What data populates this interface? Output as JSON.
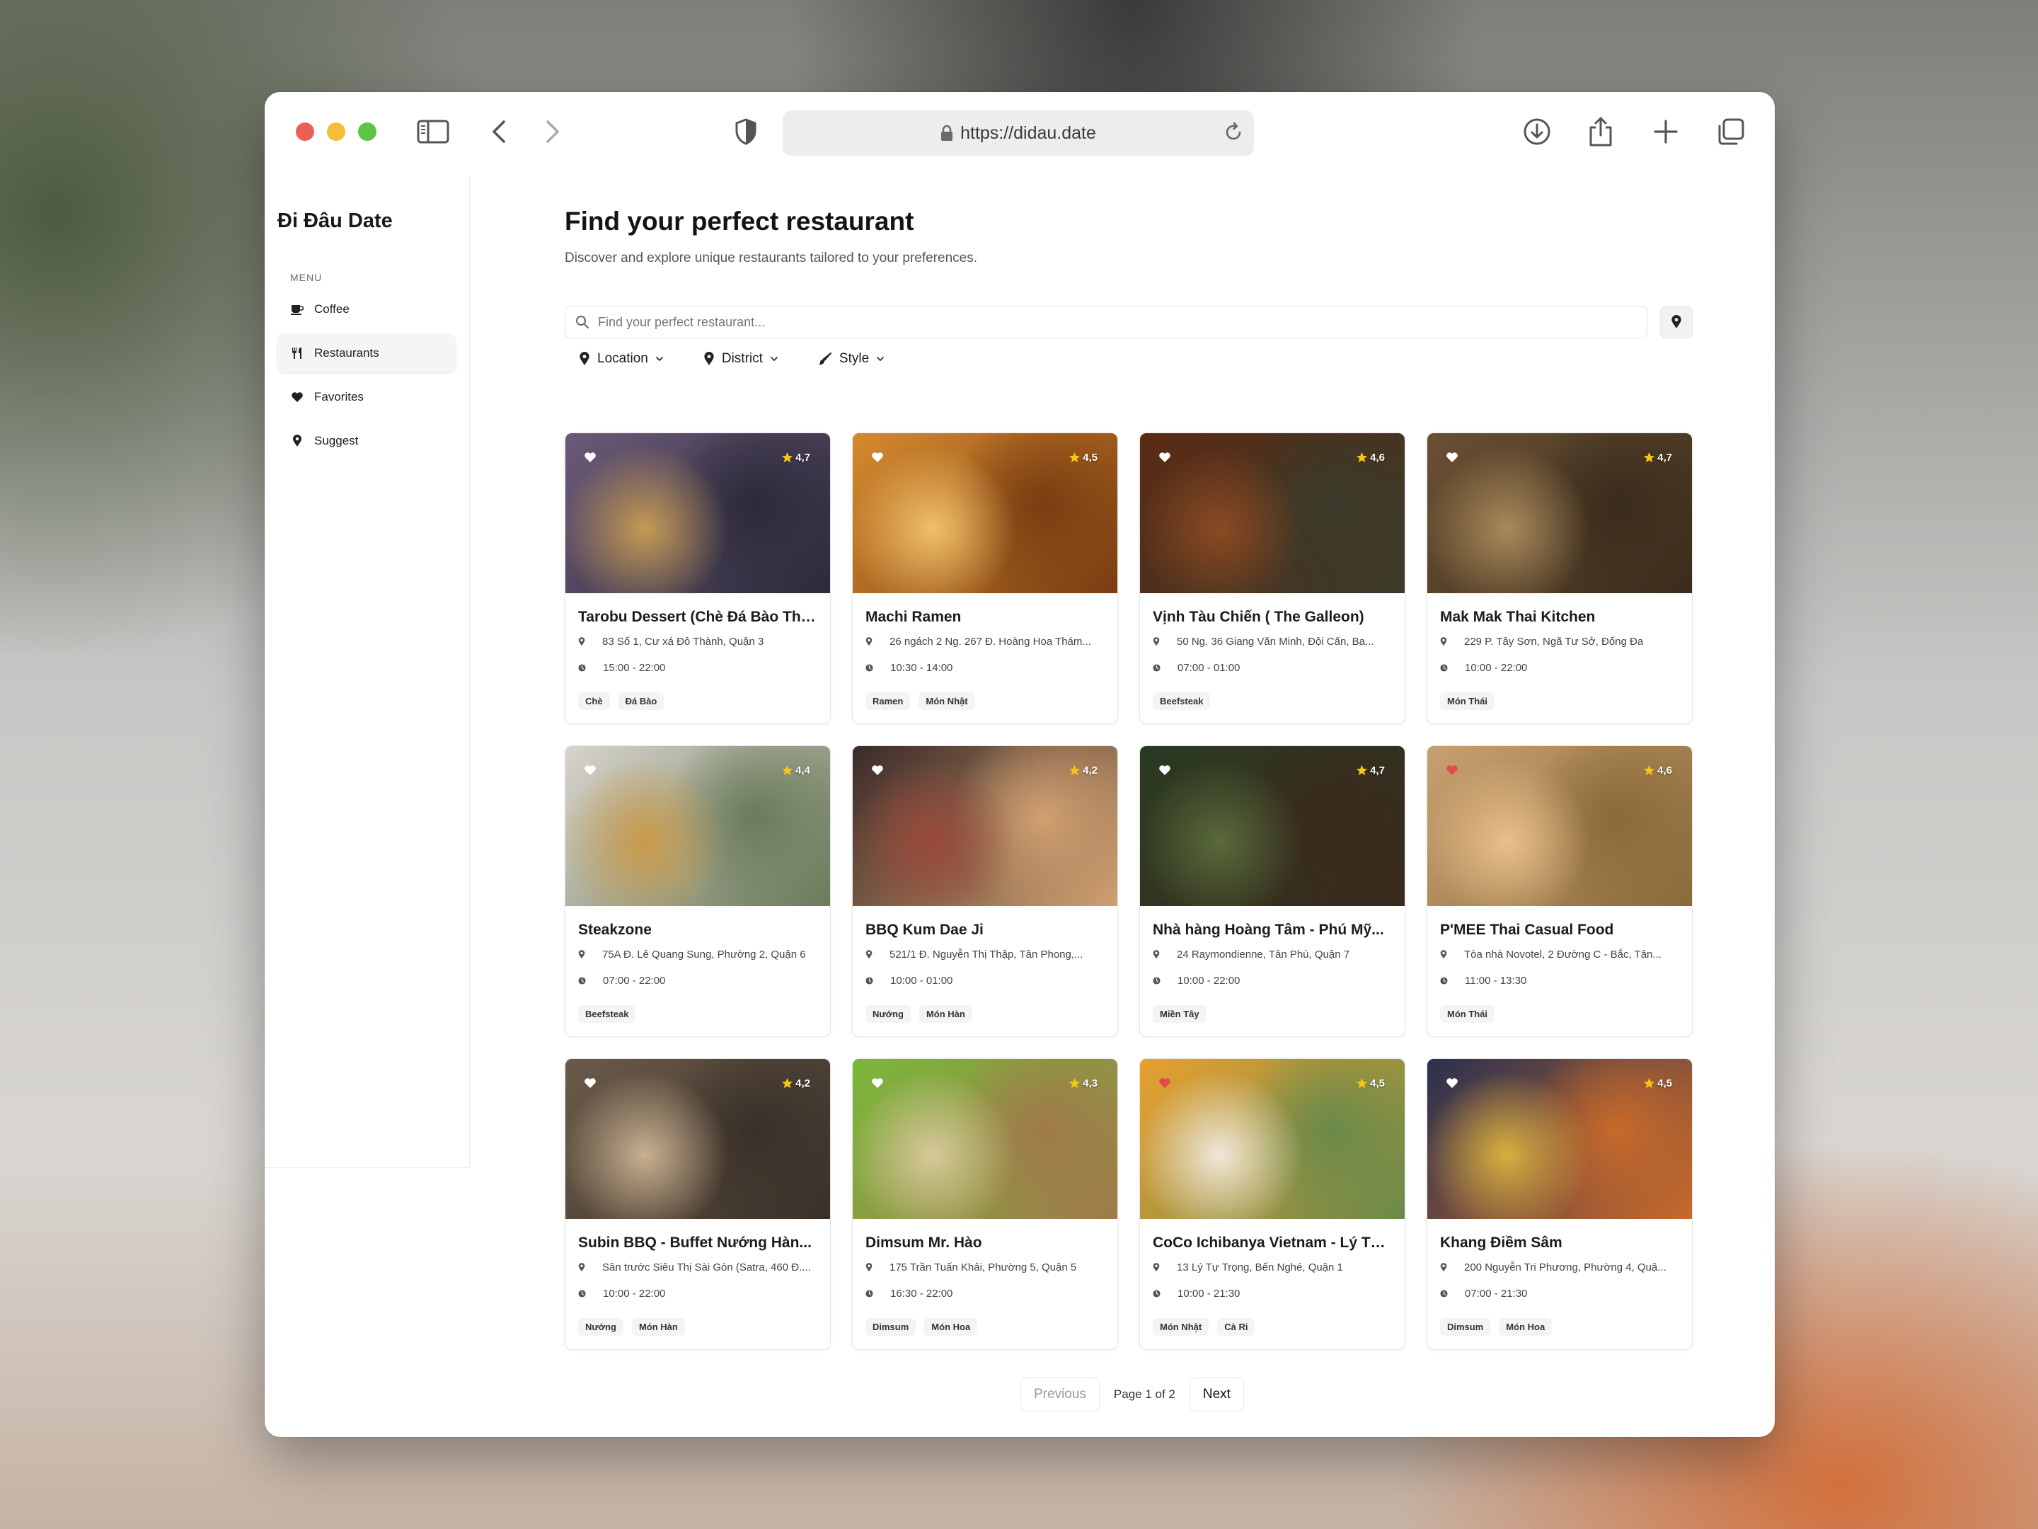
{
  "browser": {
    "url": "https://didau.date"
  },
  "sidebar": {
    "brand": "Đi Đâu Date",
    "menu_label": "MENU",
    "items": [
      {
        "label": "Coffee",
        "icon": "coffee-icon"
      },
      {
        "label": "Restaurants",
        "icon": "utensils-icon",
        "active": true
      },
      {
        "label": "Favorites",
        "icon": "heart-icon"
      },
      {
        "label": "Suggest",
        "icon": "map-pin-icon"
      }
    ]
  },
  "main": {
    "title": "Find your perfect restaurant",
    "subtitle": "Discover and explore unique restaurants tailored to your preferences.",
    "search_placeholder": "Find your perfect restaurant...",
    "filters": [
      {
        "label": "Location",
        "icon": "map-pin-icon"
      },
      {
        "label": "District",
        "icon": "map-pin-icon"
      },
      {
        "label": "Style",
        "icon": "brush-icon"
      }
    ]
  },
  "restaurants": [
    {
      "name": "Tarobu Dessert (Chè Đá Bào Thảo...",
      "address": "83 Số 1, Cư xá Đô Thành, Quận 3",
      "hours": "15:00 - 22:00",
      "rating": "4,7",
      "tags": [
        "Chè",
        "Đá Bào"
      ],
      "favorite": false,
      "photo": [
        "#6b5a78",
        "#c59a54",
        "#2c2a3a"
      ]
    },
    {
      "name": "Machi Ramen",
      "address": "26 ngách 2 Ng. 267 Đ. Hoàng Hoa Thám...",
      "hours": "10:30 - 14:00",
      "rating": "4,5",
      "tags": [
        "Ramen",
        "Món Nhật"
      ],
      "favorite": false,
      "photo": [
        "#d48a2e",
        "#f0c06a",
        "#7a3d12"
      ]
    },
    {
      "name": "Vịnh Tàu Chiến ( The Galleon)",
      "address": "50 Ng. 36 Giang Văn Minh, Đội Cấn, Ba...",
      "hours": "07:00 - 01:00",
      "rating": "4,6",
      "tags": [
        "Beefsteak"
      ],
      "favorite": false,
      "photo": [
        "#5a2a14",
        "#8a4a22",
        "#3a3a2a"
      ]
    },
    {
      "name": "Mak Mak Thai Kitchen",
      "address": "229 P. Tây Sơn, Ngã Tư Sở, Đống Đa",
      "hours": "10:00 - 22:00",
      "rating": "4,7",
      "tags": [
        "Món Thái"
      ],
      "favorite": false,
      "photo": [
        "#6a5034",
        "#a88a5a",
        "#3a2c1c"
      ]
    },
    {
      "name": "Steakzone",
      "address": "75A Đ. Lê Quang Sung, Phường 2, Quận 6",
      "hours": "07:00 - 22:00",
      "rating": "4,4",
      "tags": [
        "Beefsteak"
      ],
      "favorite": false,
      "photo": [
        "#d8d4cc",
        "#c99a4a",
        "#6a7a5a"
      ]
    },
    {
      "name": "BBQ Kum Dae Ji",
      "address": "521/1 Đ. Nguyễn Thị Thập, Tân Phong,...",
      "hours": "10:00 - 01:00",
      "rating": "4,2",
      "tags": [
        "Nướng",
        "Món Hàn"
      ],
      "favorite": false,
      "photo": [
        "#3a2a28",
        "#9a4a3a",
        "#d0a070"
      ]
    },
    {
      "name": "Nhà hàng Hoàng Tâm - Phú Mỹ...",
      "address": "24 Raymondienne, Tân Phú, Quận 7",
      "hours": "10:00 - 22:00",
      "rating": "4,7",
      "tags": [
        "Miền Tây"
      ],
      "favorite": false,
      "photo": [
        "#2a3a22",
        "#5a6a3a",
        "#3a2a1e"
      ]
    },
    {
      "name": "P'MEE Thai Casual Food",
      "address": "Tòa nhà Novotel, 2 Đường C - Bắc, Tân...",
      "hours": "11:00 - 13:30",
      "rating": "4,6",
      "tags": [
        "Món Thái"
      ],
      "favorite": true,
      "photo": [
        "#c8a070",
        "#e8c08a",
        "#8a6a3a"
      ]
    },
    {
      "name": "Subin BBQ - Buffet Nướng Hàn...",
      "address": "Sân trước Siêu Thị Sài Gòn (Satra, 460 Đ....",
      "hours": "10:00 - 22:00",
      "rating": "4,2",
      "tags": [
        "Nướng",
        "Món Hàn"
      ],
      "favorite": false,
      "photo": [
        "#6a5a4a",
        "#c8b090",
        "#3a3028"
      ]
    },
    {
      "name": "Dimsum Mr. Hào",
      "address": "175 Trần Tuấn Khải, Phường 5, Quận 5",
      "hours": "16:30 - 22:00",
      "rating": "4,3",
      "tags": [
        "Dimsum",
        "Món Hoa"
      ],
      "favorite": false,
      "photo": [
        "#7ab83a",
        "#d8c89a",
        "#a07a4a"
      ]
    },
    {
      "name": "CoCo Ichibanya Vietnam - Lý Tự...",
      "address": "13 Lý Tự Trọng, Bến Nghé, Quận 1",
      "hours": "10:00 - 21:30",
      "rating": "4,5",
      "tags": [
        "Món Nhật",
        "Cà Ri"
      ],
      "favorite": true,
      "photo": [
        "#e8a030",
        "#f0e8d8",
        "#6a8a4a"
      ]
    },
    {
      "name": "Khang Điềm Sâm",
      "address": "200 Nguyễn Tri Phương, Phường 4, Quậ...",
      "hours": "07:00 - 21:30",
      "rating": "4,5",
      "tags": [
        "Dimsum",
        "Món Hoa"
      ],
      "favorite": false,
      "photo": [
        "#2a3050",
        "#d8b040",
        "#c86a2a"
      ]
    }
  ],
  "pagination": {
    "previous": "Previous",
    "info": "Page 1 of 2",
    "next": "Next"
  }
}
